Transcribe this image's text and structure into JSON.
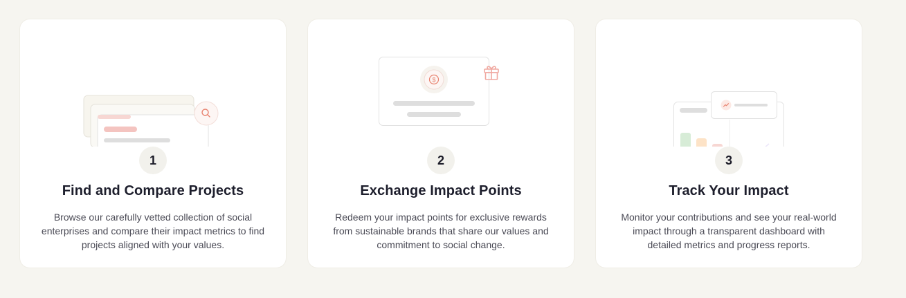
{
  "steps": [
    {
      "number": "1",
      "title": "Find and Compare Projects",
      "description": "Browse our carefully vetted collection of social enterprises and compare their impact metrics to find projects aligned with your values.",
      "illustration_icon": "search-icon"
    },
    {
      "number": "2",
      "title": "Exchange Impact Points",
      "description": "Redeem your impact points for exclusive rewards from sustainable brands that share our values and commitment to social change.",
      "illustration_icon": "gift-icon"
    },
    {
      "number": "3",
      "title": "Track Your Impact",
      "description": "Monitor your contributions and see your real-world impact through a transparent dashboard with detailed metrics and progress reports.",
      "illustration_icon": "chart-icon"
    }
  ],
  "colors": {
    "background": "#f6f5f0",
    "card": "#ffffff",
    "accent": "#e8826f",
    "accent_soft": "#f4c4c0",
    "placeholder": "#dedede",
    "text_dark": "#1d1e2c",
    "text_body": "#4a4a55"
  }
}
